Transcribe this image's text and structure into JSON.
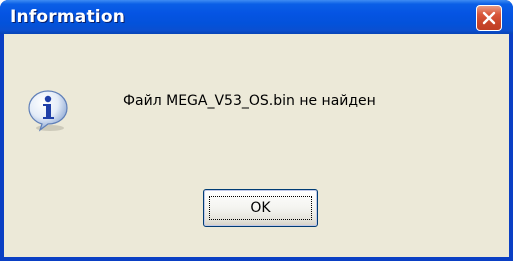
{
  "window": {
    "title": "Information",
    "close_icon": "close-icon"
  },
  "dialog": {
    "icon": "information-icon",
    "message": "Файл MEGA_V53_OS.bin не найден"
  },
  "buttons": {
    "ok_label": "OK"
  },
  "colors": {
    "titlebar": "#0554e3",
    "client_background": "#ece9d8",
    "close_button": "#d9573a"
  }
}
